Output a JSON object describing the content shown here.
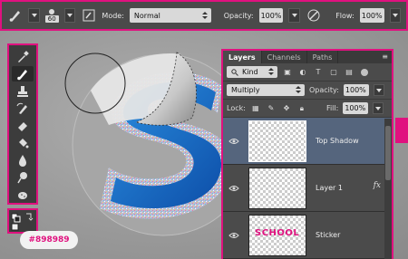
{
  "options_bar": {
    "brush_size": "60",
    "mode_label": "Mode:",
    "mode_value": "Normal",
    "opacity_label": "Opacity:",
    "opacity_value": "100%",
    "flow_label": "Flow:",
    "flow_value": "100%"
  },
  "layers_panel": {
    "tabs": [
      {
        "label": "Layers",
        "active": true
      },
      {
        "label": "Channels",
        "active": false
      },
      {
        "label": "Paths",
        "active": false
      }
    ],
    "filter_kind": "Kind",
    "blend_mode": "Multiply",
    "opacity_label": "Opacity:",
    "opacity_value": "100%",
    "lock_label": "Lock:",
    "fill_label": "Fill:",
    "fill_value": "100%",
    "layers": [
      {
        "name": "Top Shadow",
        "selected": true,
        "has_fx": false
      },
      {
        "name": "Layer 1",
        "selected": false,
        "has_fx": true
      },
      {
        "name": "Sticker",
        "selected": false,
        "has_fx": false
      }
    ],
    "fx_label": "fx",
    "sticker_thumb_text": "SCHOOL"
  },
  "color_badge": "#898989",
  "colors": {
    "accent": "#e0117f",
    "canvas_gray": "#9a9a9a",
    "letter_blue": "#1a6fc9",
    "selected_layer": "#55657d"
  }
}
